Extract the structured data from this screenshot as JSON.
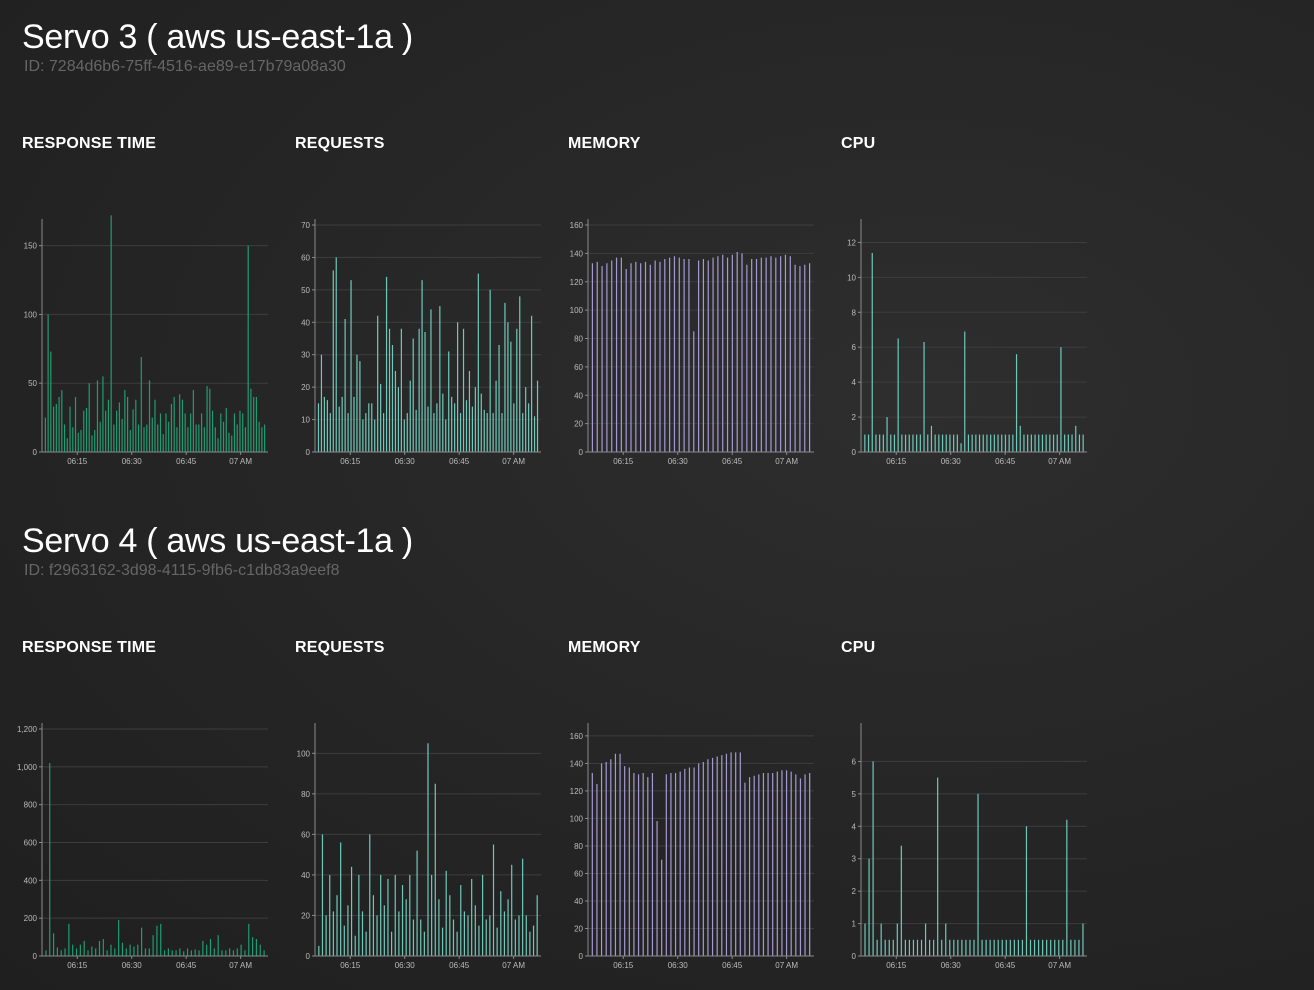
{
  "colors": {
    "green": "#1f9c72",
    "teal": "#6fc9ba",
    "purple": "#a59ad0",
    "axis": "#8a8a8a",
    "grid": "#3d3d3d"
  },
  "servers": [
    {
      "title": "Servo 3 ( aws us-east-1a )",
      "id_text": "ID: 7284d6b6-75ff-4516-ae89-e17b79a08a30",
      "charts": [
        {
          "label": "RESPONSE TIME",
          "chart_data": {
            "type": "bar",
            "color_key": "green",
            "ylim": [
              0,
              165
            ],
            "y_ticks": [
              "0",
              "50",
              "100",
              "150"
            ],
            "x_ticks": [
              "06:15",
              "06:30",
              "06:45",
              "07 AM"
            ],
            "grid": true,
            "values": [
              25,
              100,
              73,
              33,
              35,
              40,
              45,
              20,
              10,
              33,
              18,
              40,
              14,
              16,
              30,
              32,
              50,
              12,
              16,
              52,
              22,
              55,
              30,
              38,
              172,
              20,
              30,
              36,
              24,
              45,
              40,
              16,
              31,
              38,
              20,
              69,
              18,
              20,
              52,
              25,
              38,
              20,
              28,
              13,
              28,
              22,
              35,
              40,
              18,
              42,
              38,
              28,
              18,
              28,
              45,
              20,
              20,
              28,
              18,
              48,
              46,
              30,
              18,
              10,
              28,
              22,
              32,
              14,
              12,
              28,
              20,
              30,
              28,
              18,
              150,
              46,
              40,
              40,
              22,
              18,
              20
            ]
          }
        },
        {
          "label": "REQUESTS",
          "chart_data": {
            "type": "bar",
            "color_key": "teal",
            "ylim": [
              0,
              70
            ],
            "y_ticks": [
              "0",
              "10",
              "20",
              "30",
              "40",
              "50",
              "60",
              "70"
            ],
            "x_ticks": [
              "06:15",
              "06:30",
              "06:45",
              "07 AM"
            ],
            "grid": true,
            "values": [
              15,
              30,
              17,
              16,
              12,
              56,
              60,
              14,
              17,
              41,
              12,
              53,
              17,
              30,
              28,
              10,
              12,
              15,
              15,
              10,
              42,
              21,
              12,
              54,
              38,
              33,
              25,
              20,
              38,
              10,
              12,
              22,
              35,
              13,
              38,
              53,
              37,
              14,
              44,
              12,
              15,
              45,
              18,
              10,
              31,
              17,
              15,
              40,
              12,
              38,
              16,
              25,
              14,
              20,
              55,
              18,
              13,
              12,
              50,
              12,
              22,
              33,
              12,
              46,
              40,
              34,
              15,
              38,
              48,
              12,
              20,
              15,
              42,
              11,
              22
            ]
          }
        },
        {
          "label": "MEMORY",
          "chart_data": {
            "type": "bar",
            "color_key": "purple",
            "ylim": [
              0,
              160
            ],
            "y_ticks": [
              "0",
              "20",
              "40",
              "60",
              "80",
              "100",
              "120",
              "140",
              "160"
            ],
            "x_ticks": [
              "06:15",
              "06:30",
              "06:45",
              "07 AM"
            ],
            "grid": true,
            "values": [
              133,
              134,
              131,
              133,
              135,
              137,
              137,
              129,
              133,
              134,
              133,
              134,
              132,
              135,
              134,
              136,
              137,
              138,
              137,
              136,
              136,
              85,
              135,
              136,
              135,
              137,
              138,
              139,
              137,
              139,
              141,
              140,
              132,
              136,
              136,
              137,
              137,
              138,
              137,
              138,
              139,
              138,
              132,
              131,
              132,
              133
            ]
          }
        },
        {
          "label": "CPU",
          "chart_data": {
            "type": "bar",
            "color_key": "teal",
            "ylim": [
              0,
              13
            ],
            "y_ticks": [
              "0",
              "2",
              "4",
              "6",
              "8",
              "10",
              "12"
            ],
            "x_ticks": [
              "06:15",
              "06:30",
              "06:45",
              "07 AM"
            ],
            "grid": true,
            "values": [
              1,
              1,
              11.4,
              1,
              1,
              1,
              2,
              1,
              1,
              6.5,
              1,
              1,
              1,
              1,
              1,
              1,
              6.3,
              1,
              1.5,
              1,
              1,
              1,
              1,
              1,
              1,
              1,
              0.5,
              6.9,
              1,
              1,
              1,
              1,
              1,
              1,
              1,
              1,
              1,
              1,
              1,
              1,
              1,
              5.6,
              1.5,
              1,
              1,
              1,
              1,
              1,
              1,
              1,
              1,
              1,
              1,
              6,
              1,
              1,
              1,
              1.5,
              1,
              1
            ]
          }
        }
      ]
    },
    {
      "title": "Servo 4 ( aws us-east-1a )",
      "id_text": "ID: f2963162-3d98-4115-9fb6-c1db83a9eef8",
      "charts": [
        {
          "label": "RESPONSE TIME",
          "chart_data": {
            "type": "bar",
            "color_key": "green",
            "ylim": [
              0,
              1200
            ],
            "y_ticks": [
              "0",
              "200",
              "400",
              "600",
              "800",
              "1,000",
              "1,200"
            ],
            "x_ticks": [
              "06:15",
              "06:30",
              "06:45",
              "07 AM"
            ],
            "grid": true,
            "values": [
              30,
              1020,
              120,
              45,
              30,
              40,
              170,
              60,
              40,
              60,
              80,
              30,
              50,
              40,
              80,
              90,
              30,
              60,
              40,
              190,
              70,
              40,
              60,
              50,
              60,
              150,
              40,
              40,
              110,
              160,
              170,
              30,
              40,
              30,
              30,
              40,
              25,
              40,
              30,
              35,
              30,
              80,
              60,
              90,
              40,
              110,
              30,
              30,
              40,
              30,
              40,
              60,
              30,
              170,
              100,
              90,
              60,
              30
            ]
          }
        },
        {
          "label": "REQUESTS",
          "chart_data": {
            "type": "bar",
            "color_key": "teal",
            "ylim": [
              0,
              112
            ],
            "y_ticks": [
              "0",
              "20",
              "40",
              "60",
              "80",
              "100"
            ],
            "x_ticks": [
              "06:15",
              "06:30",
              "06:45",
              "07 AM"
            ],
            "grid": true,
            "values": [
              5,
              60,
              20,
              40,
              22,
              30,
              56,
              15,
              25,
              44,
              10,
              40,
              22,
              12,
              60,
              30,
              20,
              40,
              25,
              38,
              12,
              40,
              22,
              35,
              28,
              40,
              18,
              52,
              18,
              12,
              105,
              40,
              85,
              28,
              14,
              42,
              30,
              18,
              12,
              35,
              22,
              20,
              38,
              25,
              15,
              40,
              18,
              20,
              55,
              14,
              32,
              22,
              28,
              45,
              18,
              20,
              48,
              20,
              12,
              15,
              30
            ]
          }
        },
        {
          "label": "MEMORY",
          "chart_data": {
            "type": "bar",
            "color_key": "purple",
            "ylim": [
              0,
              165
            ],
            "y_ticks": [
              "0",
              "20",
              "40",
              "60",
              "80",
              "100",
              "120",
              "140",
              "160"
            ],
            "x_ticks": [
              "06:15",
              "06:30",
              "06:45",
              "07 AM"
            ],
            "grid": true,
            "values": [
              133,
              125,
              140,
              141,
              143,
              147,
              147,
              138,
              137,
              133,
              132,
              133,
              130,
              133,
              98,
              70,
              132,
              133,
              133,
              134,
              136,
              137,
              137,
              140,
              141,
              143,
              144,
              145,
              146,
              147,
              148,
              148,
              148,
              126,
              130,
              131,
              132,
              133,
              133,
              133,
              134,
              135,
              135,
              134,
              132,
              129,
              132,
              133
            ]
          }
        },
        {
          "label": "CPU",
          "chart_data": {
            "type": "bar",
            "color_key": "teal",
            "ylim": [
              0,
              7
            ],
            "y_ticks": [
              "0",
              "1",
              "2",
              "3",
              "4",
              "5",
              "6"
            ],
            "x_ticks": [
              "06:15",
              "06:30",
              "06:45",
              "07 AM"
            ],
            "grid": true,
            "values": [
              1,
              3,
              6,
              0.5,
              1,
              0.5,
              0.5,
              0.5,
              1,
              3.4,
              0.5,
              0.5,
              0.5,
              0.5,
              0.5,
              1,
              0.5,
              0.5,
              5.5,
              0.5,
              1,
              0.5,
              0.5,
              0.5,
              0.5,
              0.5,
              0.5,
              0.5,
              5,
              0.5,
              0.5,
              0.5,
              0.5,
              0.5,
              0.5,
              0.5,
              0.5,
              0.5,
              0.5,
              0.5,
              4,
              0.5,
              0.5,
              0.5,
              0.5,
              0.5,
              0.5,
              0.5,
              0.5,
              0.5,
              4.2,
              0.5,
              0.5,
              0.5,
              1
            ]
          }
        }
      ]
    }
  ]
}
